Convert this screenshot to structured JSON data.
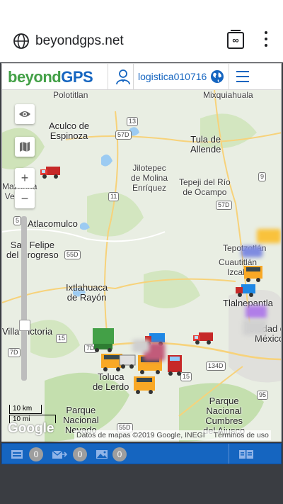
{
  "browser": {
    "url": "beyondgps.net",
    "tabs_label": "∞"
  },
  "header": {
    "logo_beyond": "beyond",
    "logo_gps": "GPS",
    "username": "logistica010716"
  },
  "map": {
    "places": [
      {
        "name": "Polotitlan",
        "id": "polotitlan"
      },
      {
        "name": "Mixquiahuala",
        "id": "mixquiahuala"
      },
      {
        "name": "Aculco de\nEspinoza",
        "id": "aculco"
      },
      {
        "name": "Tula de\nAllende",
        "id": "tula"
      },
      {
        "name": "Jilotepec\nde Molina\nEnríquez",
        "id": "jilotepec"
      },
      {
        "name": "Tepeji del Río\nde Ocampo",
        "id": "tepeji"
      },
      {
        "name": "San Felipe\ndel Progreso",
        "id": "sanfelipe"
      },
      {
        "name": "Atlacomulco",
        "id": "atlacomulco"
      },
      {
        "name": "Ixtlahuaca\nde Rayón",
        "id": "ixtlahuaca"
      },
      {
        "name": "Tepotzotlán",
        "id": "tepotzotlan"
      },
      {
        "name": "Cuautitlán\nIzcalli",
        "id": "cuautitlan"
      },
      {
        "name": "Tlalnepantla",
        "id": "tlalnepantla"
      },
      {
        "name": "Ciudad de\nMéxico",
        "id": "cdmx"
      },
      {
        "name": "Villa Victoria",
        "id": "villavictoria"
      },
      {
        "name": "Toluca\nde Lerdo",
        "id": "toluca"
      },
      {
        "name": "Parque\nNacional\nNevado",
        "id": "nevado"
      },
      {
        "name": "Parque\nNacional\nCumbres\ndel Ajusco",
        "id": "ajusco"
      },
      {
        "name": "Mazahua\nVelasco",
        "id": "mazahua"
      }
    ],
    "road_shields": [
      "13",
      "57D",
      "57D",
      "9",
      "11",
      "55D",
      "15",
      "134D",
      "15",
      "95",
      "55D",
      "7D",
      "5"
    ],
    "zoom_in": "+",
    "zoom_out": "−",
    "scale_km": "10 km",
    "scale_mi": "10 mi",
    "google_logo": "Google",
    "attribution": "Datos de mapas ©2019 Google, INEGI",
    "terms": "Términos de uso"
  },
  "bottom_bar": {
    "alerts_count": "0",
    "messages_count": "0",
    "images_count": "0"
  },
  "colors": {
    "brand_blue": "#1565c0",
    "brand_green": "#43a047",
    "map_bg": "#e9eee3"
  }
}
